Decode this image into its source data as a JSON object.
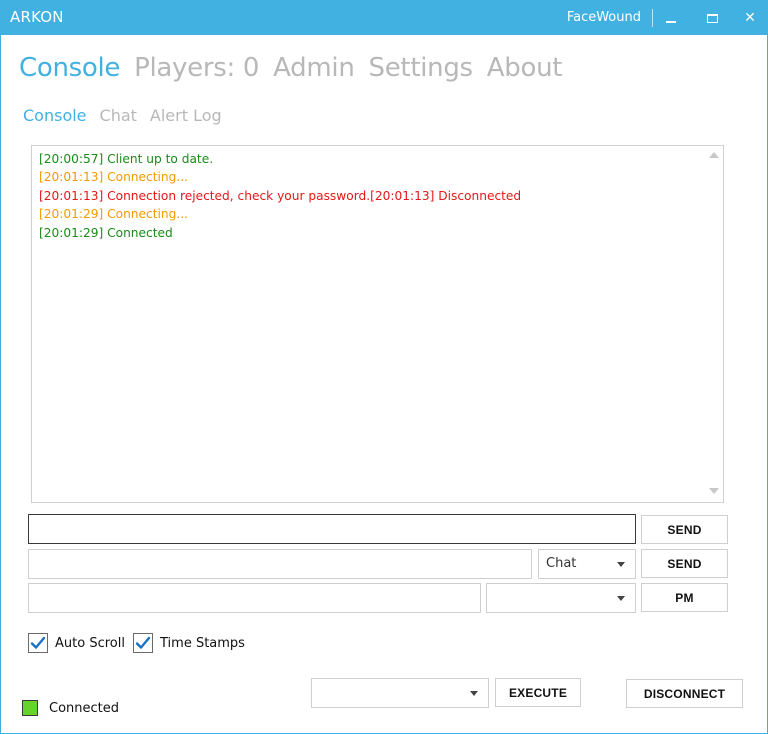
{
  "window": {
    "title": "ARKON",
    "user": "FaceWound"
  },
  "main_nav": [
    "Console",
    "Players: 0",
    "Admin",
    "Settings",
    "About"
  ],
  "sub_nav": [
    "Console",
    "Chat",
    "Alert Log"
  ],
  "console_log": [
    {
      "text": "[20:00:57] Client up to date.",
      "color": "green"
    },
    {
      "text": "[20:01:13] Connecting...",
      "color": "orange"
    },
    {
      "text": "[20:01:13] Connection rejected, check your password.[20:01:13] Disconnected",
      "color": "red"
    },
    {
      "text": "[20:01:29] Connecting...",
      "color": "orange"
    },
    {
      "text": "[20:01:29] Connected",
      "color": "green"
    }
  ],
  "command": {
    "value": "",
    "send_label": "SEND"
  },
  "chat": {
    "value": "",
    "channel": "Chat",
    "send_label": "SEND"
  },
  "pm": {
    "value": "",
    "recipient": "",
    "send_label": "PM"
  },
  "options": {
    "auto_scroll": {
      "label": "Auto Scroll",
      "checked": true
    },
    "time_stamps": {
      "label": "Time Stamps",
      "checked": true
    }
  },
  "execute": {
    "selected": "",
    "label": "EXECUTE"
  },
  "disconnect_label": "DISCONNECT",
  "status": {
    "text": "Connected",
    "color": "#66d22a"
  },
  "colors": {
    "accent": "#41b1e1",
    "log_green": "#1a8a1a",
    "log_orange": "#f29a00",
    "log_red": "#e61717",
    "inactive_tab": "#b8b8b8"
  }
}
